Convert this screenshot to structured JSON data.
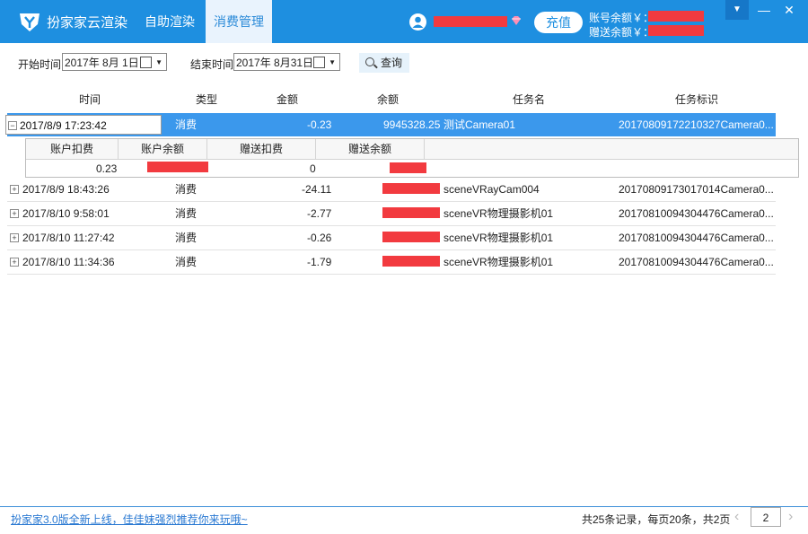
{
  "app": {
    "name": "扮家家云渲染",
    "tabs": [
      {
        "label": "自助渲染"
      },
      {
        "label": "消费管理"
      }
    ],
    "recharge_label": "充值",
    "account_balance_label": "账号余额￥：",
    "gift_balance_label": "赠送余额￥：",
    "window_controls": {
      "dropdown": "▼",
      "minimize": "—",
      "close": "✕"
    }
  },
  "filters": {
    "start_label": "开始时间",
    "start_value": "2017年 8月 1日",
    "end_label": "结束时间",
    "end_value": "2017年 8月31日",
    "query_label": "查询"
  },
  "table": {
    "headers": [
      "时间",
      "类型",
      "金额",
      "余额",
      "任务名",
      "任务标识"
    ],
    "rows": [
      {
        "expander": "−",
        "time": "2017/8/9 17:23:42",
        "type": "消费",
        "amount": "-0.23",
        "balance": "9945328.25",
        "task_name": "测试Camera01",
        "task_id": "20170809172210327Camera0..."
      },
      {
        "expander": "+",
        "time": "2017/8/9 18:43:26",
        "type": "消费",
        "amount": "-24.11",
        "balance": "",
        "task_name": "sceneVRayCam004",
        "task_id": "20170809173017014Camera0..."
      },
      {
        "expander": "+",
        "time": "2017/8/10 9:58:01",
        "type": "消费",
        "amount": "-2.77",
        "balance": "",
        "task_name": "sceneVR物理摄影机01",
        "task_id": "20170810094304476Camera0..."
      },
      {
        "expander": "+",
        "time": "2017/8/10 11:27:42",
        "type": "消费",
        "amount": "-0.26",
        "balance": "",
        "task_name": "sceneVR物理摄影机01",
        "task_id": "20170810094304476Camera0..."
      },
      {
        "expander": "+",
        "time": "2017/8/10 11:34:36",
        "type": "消费",
        "amount": "-1.79",
        "balance": "",
        "task_name": "sceneVR物理摄影机01",
        "task_id": "20170810094304476Camera0..."
      }
    ],
    "detail": {
      "headers": [
        "账户扣费",
        "账户余额",
        "赠送扣费",
        "赠送余额"
      ],
      "account_charge": "0.23",
      "gift_charge": "0"
    }
  },
  "footer": {
    "promo": "扮家家3.0版全新上线，佳佳妹强烈推荐你来玩哦~",
    "page_info": "共25条记录，每页20条，共2页",
    "page_input": "2",
    "prev_icon": "‹",
    "next_icon": "›"
  },
  "colors": {
    "titlebar": "#1e8fe0",
    "selected_row": "#3b98ec",
    "redaction": "#f23a3f",
    "link": "#2a79d2"
  }
}
